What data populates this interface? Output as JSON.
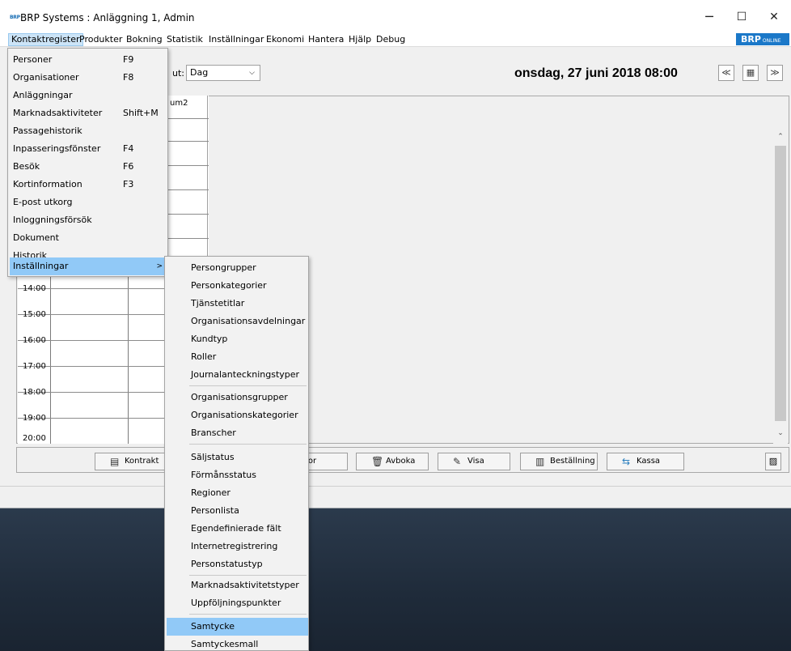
{
  "window": {
    "logo": "BRP",
    "title": "BRP Systems : Anläggning 1, Admin",
    "minimize": "─",
    "maximize": "☐",
    "close": "✕"
  },
  "menubar": {
    "items": [
      "Kontaktregister",
      "Produkter",
      "Bokning",
      "Statistik",
      "Inställningar",
      "Ekonomi",
      "Hantera",
      "Hjälp",
      "Debug"
    ],
    "badge": "BRP",
    "badge_small": "ONLINE"
  },
  "toolbar": {
    "view_label": "ut:",
    "view_value": "Dag",
    "date": "onsdag, 27 juni 2018 08:00",
    "prev": "≪",
    "calendar": "▦",
    "next": "≫"
  },
  "calendar": {
    "column_header": "um2",
    "hours": [
      "14:00",
      "15:00",
      "16:00",
      "17:00",
      "18:00",
      "19:00",
      "20:00"
    ]
  },
  "buttons": [
    {
      "label": "Kontrakt",
      "icon": "contract-icon",
      "glyph": "▤"
    },
    {
      "label": "ror",
      "icon": "",
      "glyph": ""
    },
    {
      "label": "Avboka",
      "icon": "trash-icon",
      "glyph": "🗑"
    },
    {
      "label": "Visa",
      "icon": "edit-icon",
      "glyph": "✎"
    },
    {
      "label": "Beställning",
      "icon": "book-icon",
      "glyph": "▥"
    },
    {
      "label": "Kassa",
      "icon": "cash-icon",
      "glyph": "⇆"
    }
  ],
  "dropdown": {
    "items": [
      {
        "label": "Personer",
        "shortcut": "F9"
      },
      {
        "label": "Organisationer",
        "shortcut": "F8"
      },
      {
        "label": "Anläggningar",
        "shortcut": ""
      },
      {
        "label": "Marknadsaktiviteter",
        "shortcut": "Shift+M"
      },
      {
        "label": "Passagehistorik",
        "shortcut": ""
      },
      {
        "label": "Inpasseringsfönster",
        "shortcut": "F4"
      },
      {
        "label": "Besök",
        "shortcut": "F6"
      },
      {
        "label": "Kortinformation",
        "shortcut": "F3"
      },
      {
        "label": "E-post utkorg",
        "shortcut": ""
      },
      {
        "label": "Inloggningsförsök",
        "shortcut": ""
      },
      {
        "label": "Dokument",
        "shortcut": ""
      },
      {
        "label": "Historik",
        "shortcut": ""
      },
      {
        "label": "Inställningar",
        "shortcut": ""
      }
    ],
    "sub_arrow": ">"
  },
  "submenu": {
    "groups": [
      [
        "Persongrupper",
        "Personkategorier",
        "Tjänstetitlar",
        "Organisationsavdelningar",
        "Kundtyp",
        "Roller",
        "Journalanteckningstyper"
      ],
      [
        "Organisationsgrupper",
        "Organisationskategorier",
        "Branscher"
      ],
      [
        "Säljstatus",
        "Förmånsstatus",
        "Regioner",
        "Personlista",
        "Egendefinierade fält",
        "Internetregistrering",
        "Personstatustyp"
      ],
      [
        "Marknadsaktivitetstyper",
        "Uppföljningspunkter"
      ],
      [
        "Samtycke",
        "Samtyckesmall"
      ]
    ]
  }
}
